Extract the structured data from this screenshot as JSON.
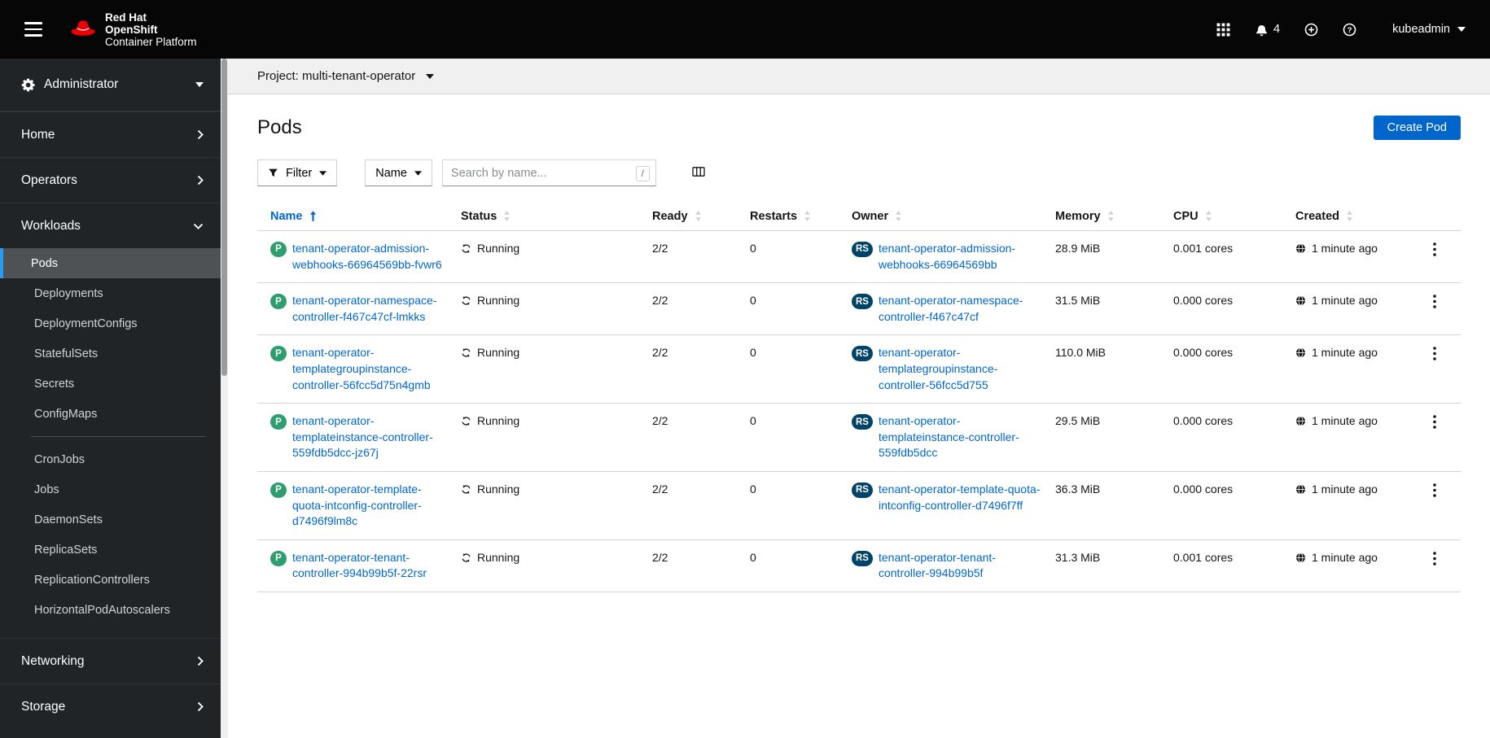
{
  "masthead": {
    "brand": {
      "line1": "Red Hat",
      "line2": "OpenShift",
      "line3": "Container Platform"
    },
    "notification_count": "4",
    "username": "kubeadmin"
  },
  "sidebar": {
    "perspective": "Administrator",
    "top_items": [
      "Home",
      "Operators",
      "Workloads",
      "Networking",
      "Storage"
    ],
    "workloads_children": [
      "Pods",
      "Deployments",
      "DeploymentConfigs",
      "StatefulSets",
      "Secrets",
      "ConfigMaps",
      "CronJobs",
      "Jobs",
      "DaemonSets",
      "ReplicaSets",
      "ReplicationControllers",
      "HorizontalPodAutoscalers"
    ],
    "selected_item": "Pods"
  },
  "project_bar": {
    "label": "Project: multi-tenant-operator"
  },
  "page": {
    "title": "Pods",
    "create_button": "Create Pod"
  },
  "toolbar": {
    "filter_label": "Filter",
    "attribute_label": "Name",
    "search_placeholder": "Search by name...",
    "search_shortcut": "/"
  },
  "table": {
    "headers": [
      "Name",
      "Status",
      "Ready",
      "Restarts",
      "Owner",
      "Memory",
      "CPU",
      "Created"
    ],
    "sorted_by": "Name",
    "sort_direction": "ascending",
    "rows": [
      {
        "badge": "P",
        "name": "tenant-operator-admission-webhooks-66964569bb-fvwr6",
        "status": "Running",
        "ready": "2/2",
        "restarts": "0",
        "owner_badge": "RS",
        "owner": "tenant-operator-admission-webhooks-66964569bb",
        "memory": "28.9 MiB",
        "cpu": "0.001 cores",
        "created": "1 minute ago"
      },
      {
        "badge": "P",
        "name": "tenant-operator-namespace-controller-f467c47cf-lmkks",
        "status": "Running",
        "ready": "2/2",
        "restarts": "0",
        "owner_badge": "RS",
        "owner": "tenant-operator-namespace-controller-f467c47cf",
        "memory": "31.5 MiB",
        "cpu": "0.000 cores",
        "created": "1 minute ago"
      },
      {
        "badge": "P",
        "name": "tenant-operator-templategroupinstance-controller-56fcc5d75n4gmb",
        "status": "Running",
        "ready": "2/2",
        "restarts": "0",
        "owner_badge": "RS",
        "owner": "tenant-operator-templategroupinstance-controller-56fcc5d755",
        "memory": "110.0 MiB",
        "cpu": "0.000 cores",
        "created": "1 minute ago"
      },
      {
        "badge": "P",
        "name": "tenant-operator-templateinstance-controller-559fdb5dcc-jz67j",
        "status": "Running",
        "ready": "2/2",
        "restarts": "0",
        "owner_badge": "RS",
        "owner": "tenant-operator-templateinstance-controller-559fdb5dcc",
        "memory": "29.5 MiB",
        "cpu": "0.000 cores",
        "created": "1 minute ago"
      },
      {
        "badge": "P",
        "name": "tenant-operator-template-quota-intconfig-controller-d7496f9lm8c",
        "status": "Running",
        "ready": "2/2",
        "restarts": "0",
        "owner_badge": "RS",
        "owner": "tenant-operator-template-quota-intconfig-controller-d7496f7ff",
        "memory": "36.3 MiB",
        "cpu": "0.000 cores",
        "created": "1 minute ago"
      },
      {
        "badge": "P",
        "name": "tenant-operator-tenant-controller-994b99b5f-22rsr",
        "status": "Running",
        "ready": "2/2",
        "restarts": "0",
        "owner_badge": "RS",
        "owner": "tenant-operator-tenant-controller-994b99b5f",
        "memory": "31.3 MiB",
        "cpu": "0.001 cores",
        "created": "1 minute ago"
      }
    ]
  },
  "colors": {
    "masthead_bg": "#060606",
    "sidebar_bg": "#212427",
    "nav_selected_bg": "#4f5255",
    "nav_selected_border": "#2b9af3",
    "link": "#0066cc",
    "primary_button": "#0066cc",
    "pod_badge": "#2e9e6e",
    "replicaset_badge": "#004368",
    "brand_red": "#ee0000"
  },
  "icons": {
    "status_icon": "sync-arrows",
    "created_icon": "globe",
    "row_menu_icon": "vertical-ellipsis",
    "filter_icon": "funnel"
  }
}
